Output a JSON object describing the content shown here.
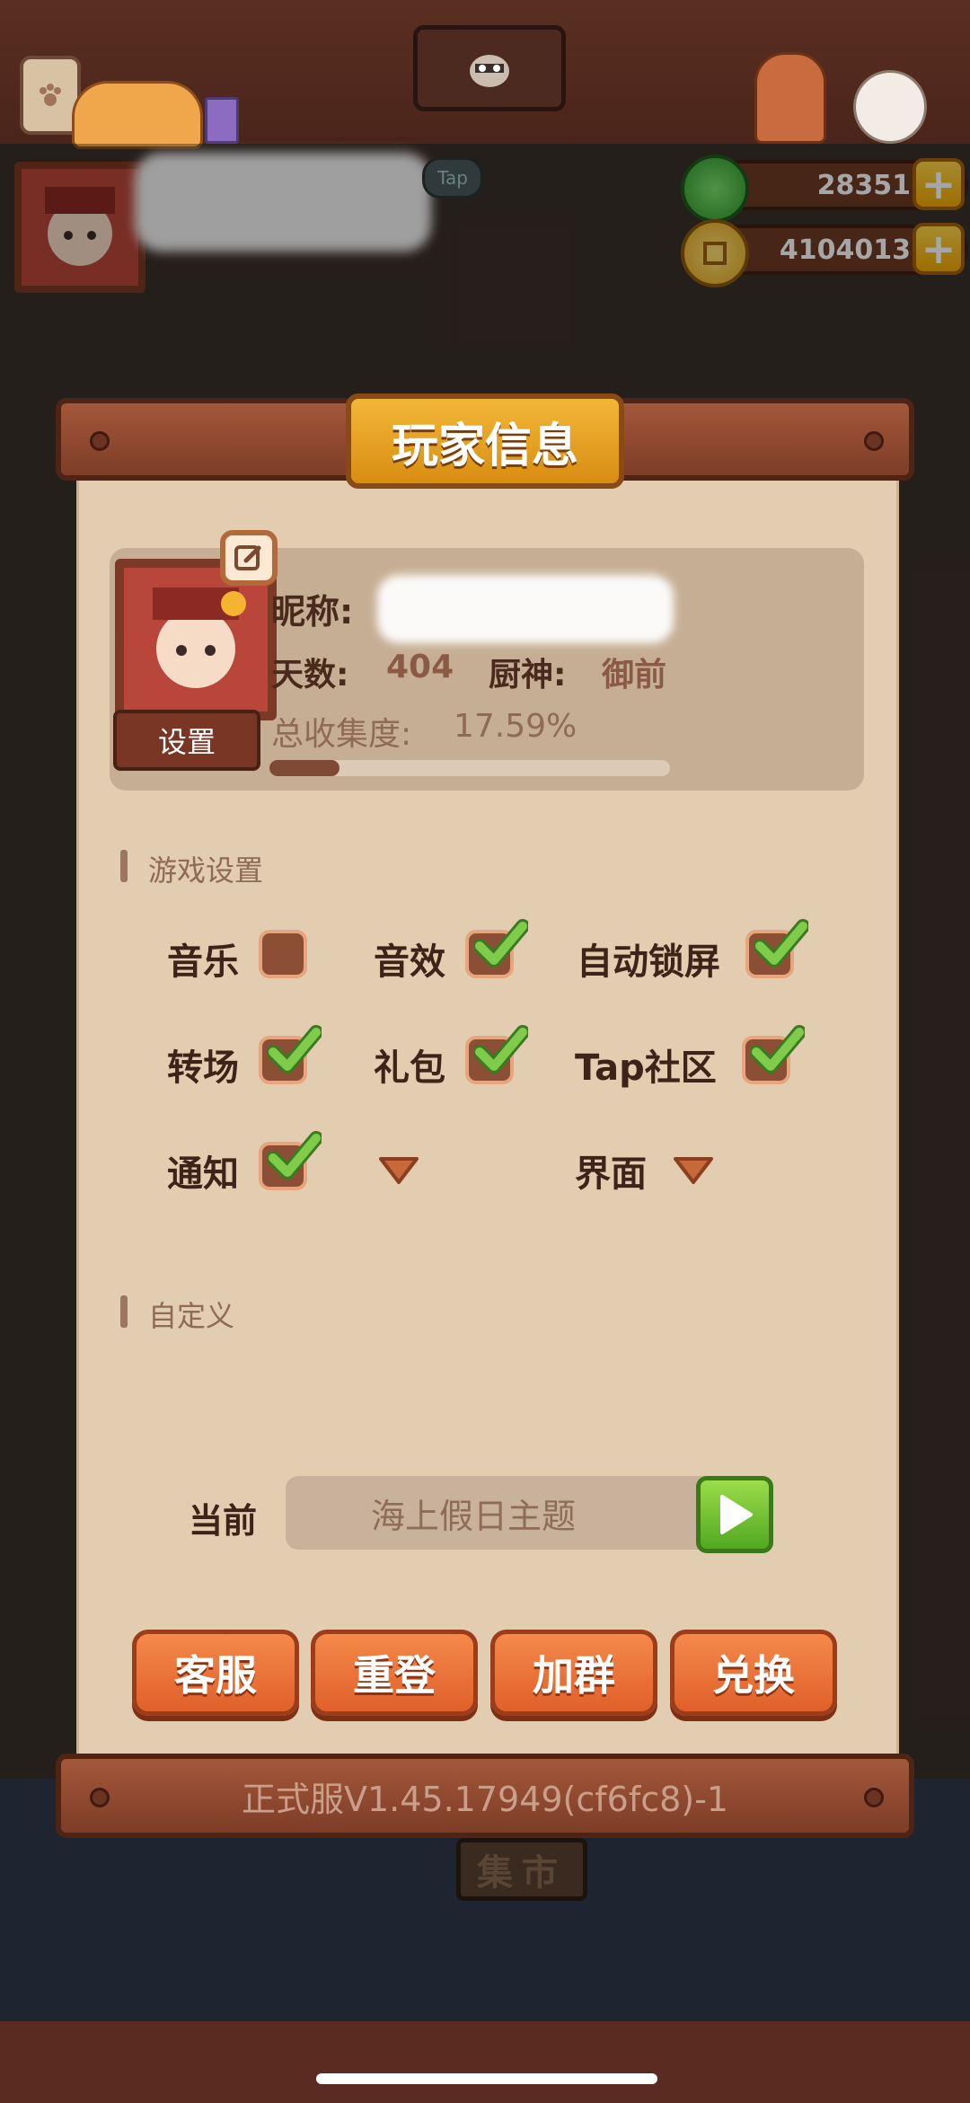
{
  "resources": {
    "jade": {
      "value": "28351",
      "icon": "jade-icon"
    },
    "coins": {
      "value": "4104013",
      "icon": "coin-icon"
    }
  },
  "header": {
    "tap_label": "Tap"
  },
  "panel": {
    "title": "玩家信息",
    "profile": {
      "nickname_label": "昵称:",
      "days_label": "天数:",
      "days_value": "404",
      "chef_god_label": "厨神:",
      "chef_god_value": "御前",
      "collection_label": "总收集度:",
      "collection_value": "17.59%",
      "collection_progress": 0.1759,
      "settings_label": "设置"
    },
    "game_settings": {
      "heading": "游戏设置",
      "options": [
        {
          "label": "音乐",
          "checked": false
        },
        {
          "label": "音效",
          "checked": true
        },
        {
          "label": "自动锁屏",
          "checked": true
        },
        {
          "label": "转场",
          "checked": true
        },
        {
          "label": "礼包",
          "checked": true
        },
        {
          "label": "Tap社区",
          "checked": true
        },
        {
          "label": "通知",
          "checked": true
        },
        {
          "label": "界面"
        }
      ]
    },
    "custom": {
      "heading": "自定义",
      "current_label": "当前",
      "current_value": "海上假日主题"
    },
    "actions": [
      "客服",
      "重登",
      "加群",
      "兑换"
    ],
    "version": "正式服V1.45.17949(cf6fc8)-1"
  },
  "background": {
    "market_sign": "集市"
  },
  "colors": {
    "panel_bg": "#e2cdb0",
    "title_plate": "#e6a222",
    "action_button": "#ec7236",
    "check_green": "#6cbf3a"
  }
}
